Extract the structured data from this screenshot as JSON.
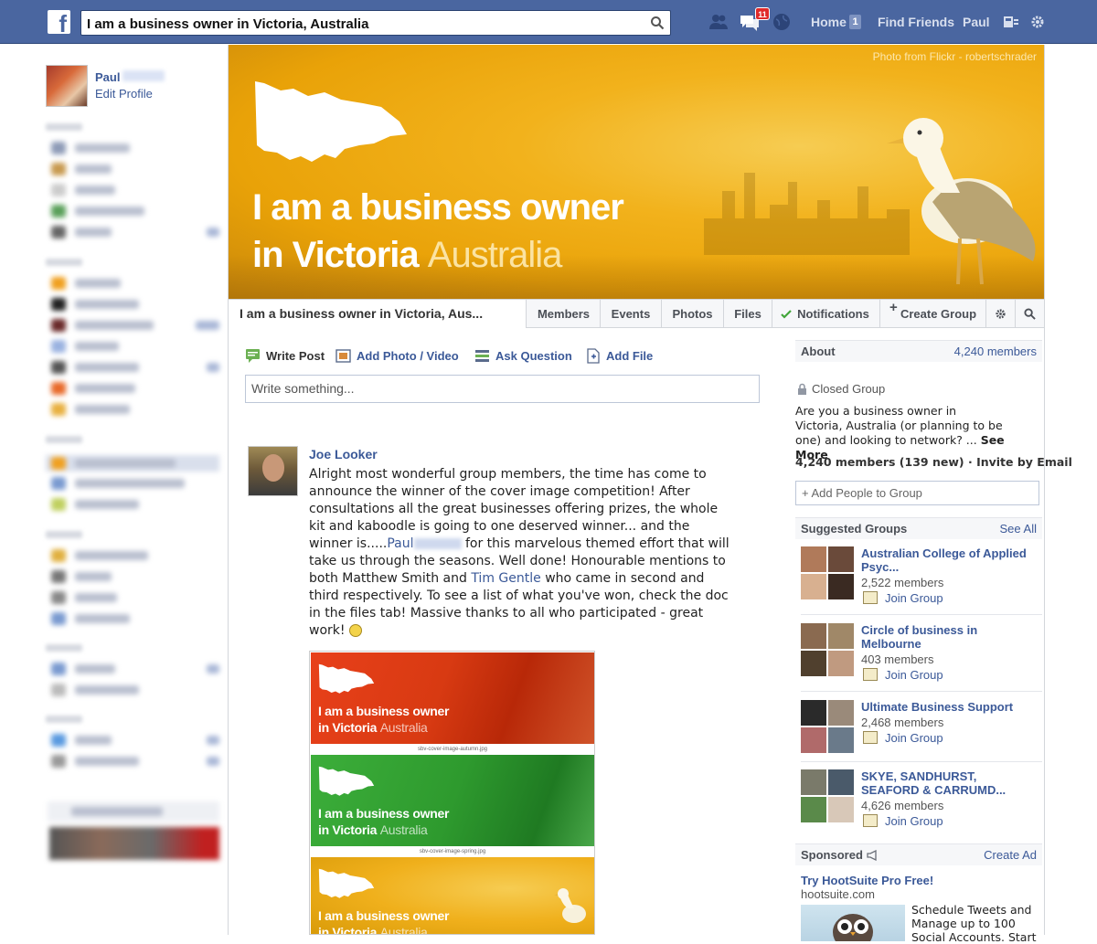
{
  "topbar": {
    "search_value": "I am a business owner in Victoria, Australia",
    "notif_count": "11",
    "home_label": "Home",
    "home_count": "1",
    "find_friends_label": "Find Friends",
    "user_label": "Paul"
  },
  "sidebar": {
    "user_name": "Paul",
    "edit_profile": "Edit Profile"
  },
  "cover": {
    "credit": "Photo from Flickr - robertschrader",
    "title_line1": "I am a business owner",
    "title_line2_main": "in Victoria",
    "title_line2_light": "Australia",
    "colors": {
      "accent": "#f2b21c"
    }
  },
  "tabs": {
    "group_name": "I am a business owner in Victoria, Aus...",
    "members": "Members",
    "events": "Events",
    "photos": "Photos",
    "files": "Files",
    "notifications": "Notifications",
    "create_group": "Create Group"
  },
  "composer": {
    "write_post": "Write Post",
    "add_photo": "Add Photo / Video",
    "ask_question": "Ask Question",
    "add_file": "Add File",
    "placeholder": "Write something..."
  },
  "post": {
    "author": "Joe Looker",
    "text_a": "Alright most wonderful group members, the time has come to announce the winner of the cover image competition! After consultations all the great businesses offering prizes, the whole kit and kaboodle is going to one deserved winner... and the winner is.....",
    "mention_1": "Paul",
    "text_b": " for this marvelous themed effort that will take us through the seasons. Well done! Honourable mentions to both Matthew Smith and ",
    "mention_2": "Tim Gentle",
    "text_c": " who came in second and third respectively. To see a list of what you've won, check the doc in the files tab! Massive thanks to all who participated - great work! ",
    "image": {
      "line1": "I am a business owner",
      "line2_main": "in Victoria",
      "line2_light": "Australia",
      "cap_autumn": "sbv-cover-image-autumn.jpg",
      "cap_spring": "sbv-cover-image-spring.jpg"
    }
  },
  "about": {
    "heading": "About",
    "members_link": "4,240 members",
    "closed_group": "Closed Group",
    "description": "Are you a business owner in Victoria, Australia (or planning to be one) and looking to network? ... ",
    "see_more": "See More",
    "member_counts": "4,240 members (139 new)",
    "separator": " · ",
    "invite": "Invite by Email",
    "add_people_placeholder": "+ Add People to Group"
  },
  "suggested": {
    "heading": "Suggested Groups",
    "see_all": "See All",
    "join_label": "Join Group",
    "groups": [
      {
        "name": "Australian College of Applied Psyc...",
        "members": "2,522 members"
      },
      {
        "name": "Circle of business in Melbourne",
        "members": "403 members"
      },
      {
        "name": "Ultimate Business Support",
        "members": "2,468 members"
      },
      {
        "name": "SKYE, SANDHURST, SEAFORD & CARRUMD...",
        "members": "4,626 members"
      }
    ]
  },
  "sponsored": {
    "heading": "Sponsored",
    "create_ad": "Create Ad",
    "title": "Try HootSuite Pro Free!",
    "domain": "hootsuite.com",
    "text": "Schedule Tweets and Manage up to 100 Social Accounts. Start"
  }
}
